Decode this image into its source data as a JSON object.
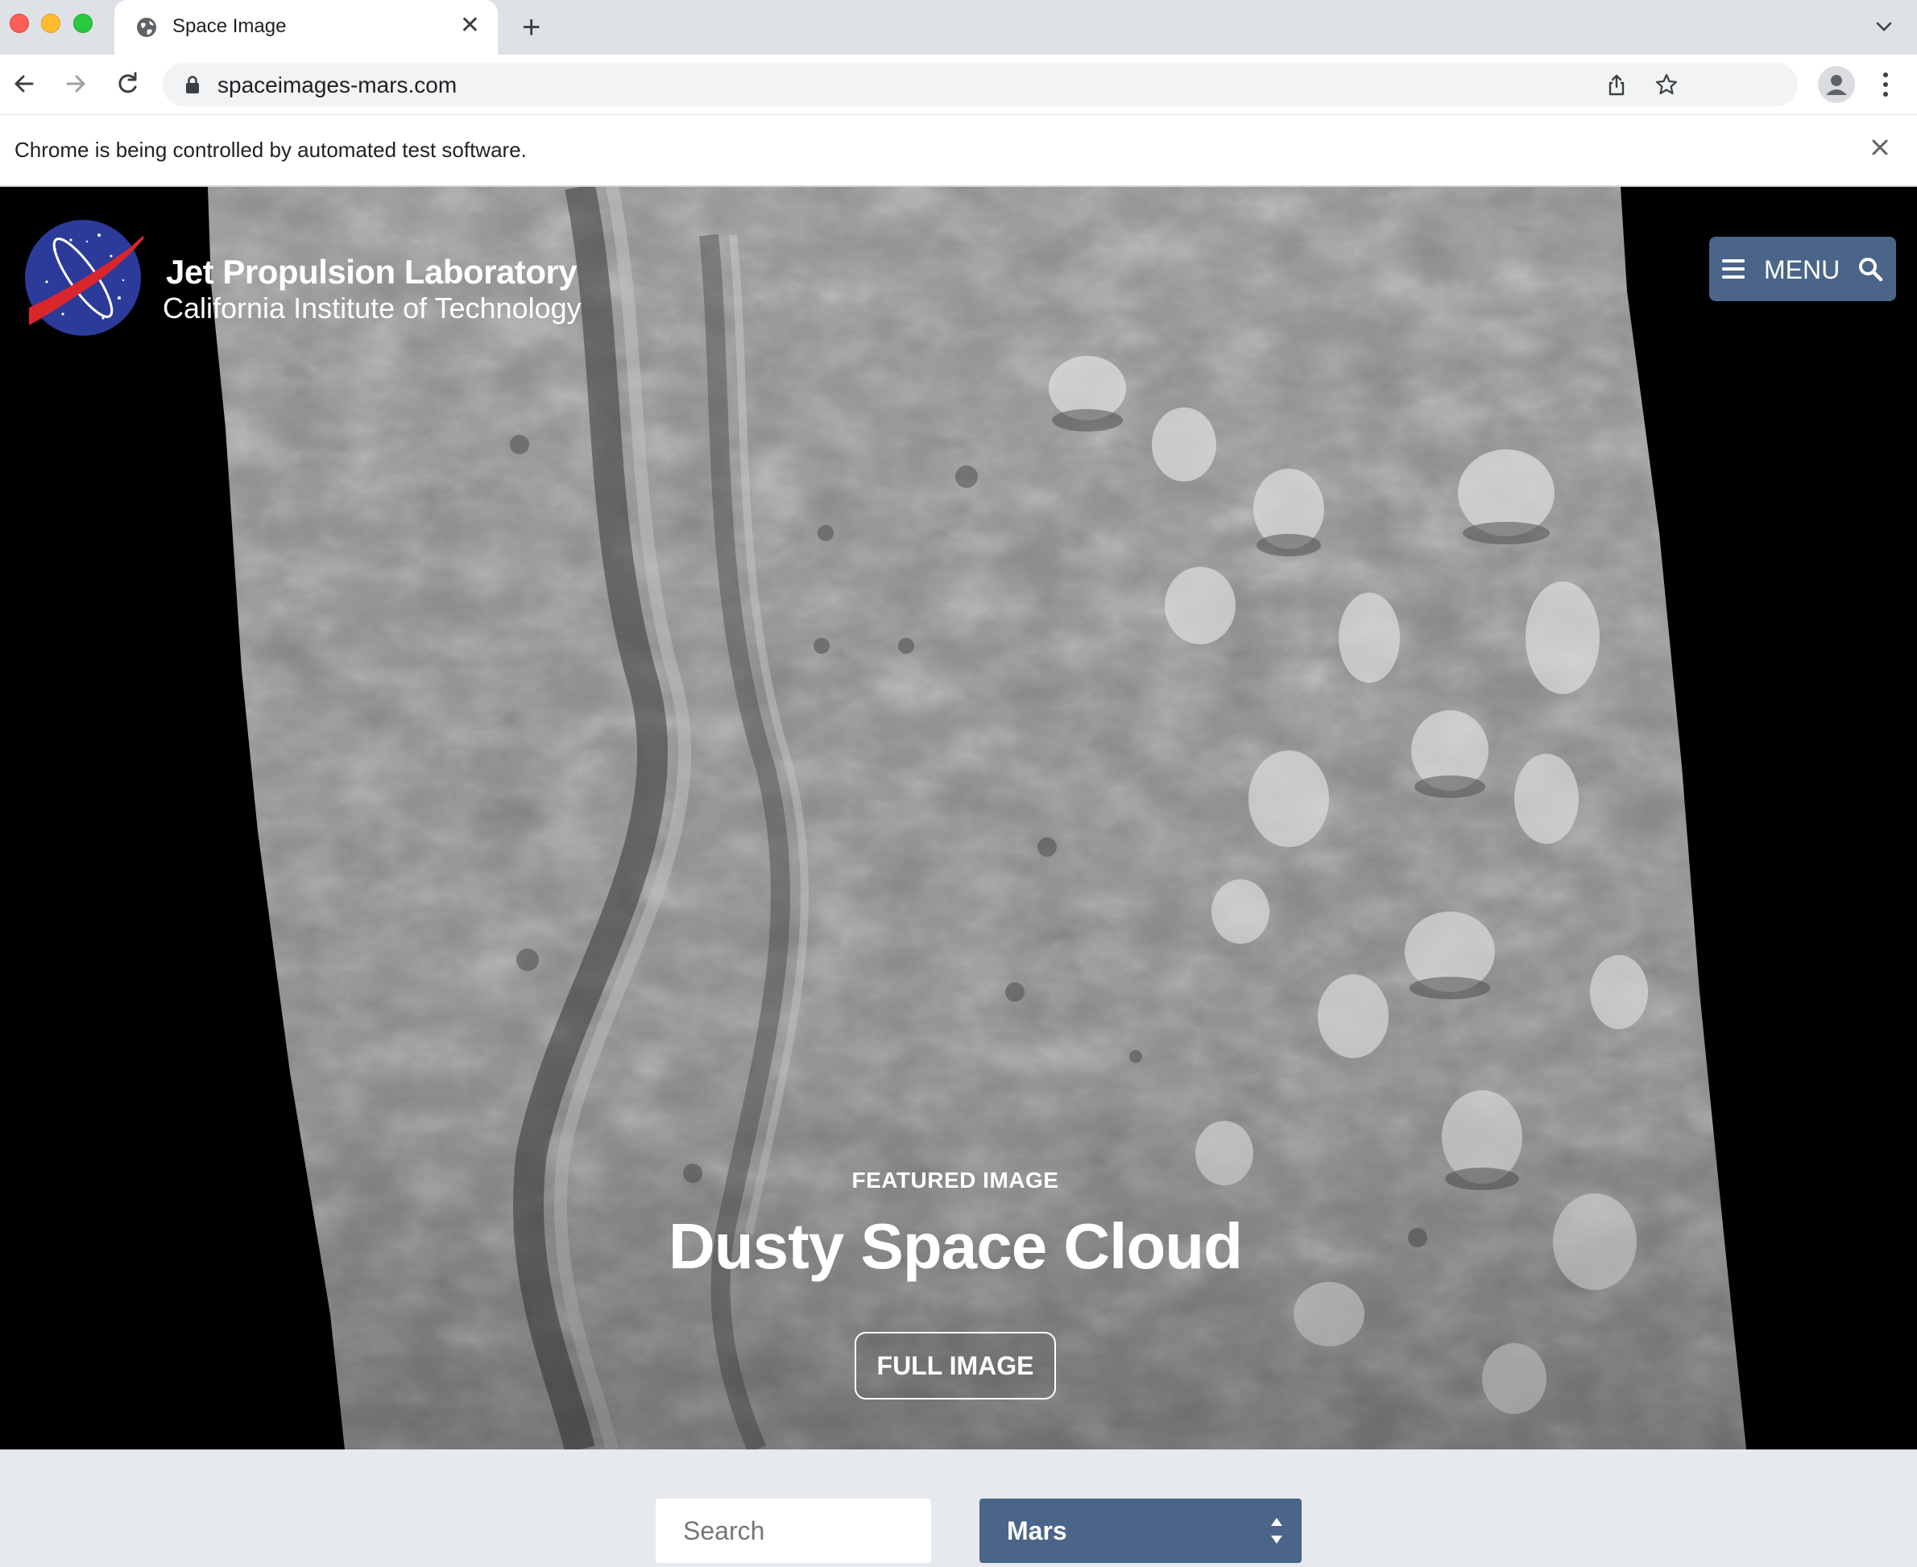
{
  "browser": {
    "tab_title": "Space Image",
    "url": "spaceimages-mars.com",
    "infobar_text": "Chrome is being controlled by automated test software."
  },
  "header": {
    "brand_title": "Jet Propulsion Laboratory",
    "brand_subtitle": "California Institute of Technology",
    "menu_label": "MENU"
  },
  "hero": {
    "kicker": "FEATURED IMAGE",
    "title": "Dusty Space Cloud",
    "button_label": "FULL IMAGE"
  },
  "filters": {
    "search_placeholder": "Search",
    "category_selected": "Mars"
  },
  "colors": {
    "menu_bg": "#4a6588",
    "page_bg": "#e6e9ee"
  }
}
